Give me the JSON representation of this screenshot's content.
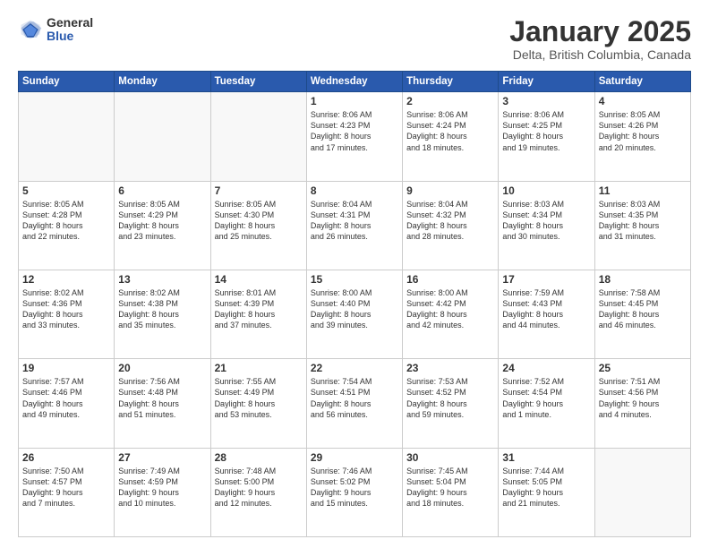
{
  "header": {
    "logo_general": "General",
    "logo_blue": "Blue",
    "title": "January 2025",
    "location": "Delta, British Columbia, Canada"
  },
  "weekdays": [
    "Sunday",
    "Monday",
    "Tuesday",
    "Wednesday",
    "Thursday",
    "Friday",
    "Saturday"
  ],
  "weeks": [
    [
      {
        "day": "",
        "text": "",
        "empty": true
      },
      {
        "day": "",
        "text": "",
        "empty": true
      },
      {
        "day": "",
        "text": "",
        "empty": true
      },
      {
        "day": "1",
        "text": "Sunrise: 8:06 AM\nSunset: 4:23 PM\nDaylight: 8 hours\nand 17 minutes.",
        "empty": false
      },
      {
        "day": "2",
        "text": "Sunrise: 8:06 AM\nSunset: 4:24 PM\nDaylight: 8 hours\nand 18 minutes.",
        "empty": false
      },
      {
        "day": "3",
        "text": "Sunrise: 8:06 AM\nSunset: 4:25 PM\nDaylight: 8 hours\nand 19 minutes.",
        "empty": false
      },
      {
        "day": "4",
        "text": "Sunrise: 8:05 AM\nSunset: 4:26 PM\nDaylight: 8 hours\nand 20 minutes.",
        "empty": false
      }
    ],
    [
      {
        "day": "5",
        "text": "Sunrise: 8:05 AM\nSunset: 4:28 PM\nDaylight: 8 hours\nand 22 minutes.",
        "empty": false
      },
      {
        "day": "6",
        "text": "Sunrise: 8:05 AM\nSunset: 4:29 PM\nDaylight: 8 hours\nand 23 minutes.",
        "empty": false
      },
      {
        "day": "7",
        "text": "Sunrise: 8:05 AM\nSunset: 4:30 PM\nDaylight: 8 hours\nand 25 minutes.",
        "empty": false
      },
      {
        "day": "8",
        "text": "Sunrise: 8:04 AM\nSunset: 4:31 PM\nDaylight: 8 hours\nand 26 minutes.",
        "empty": false
      },
      {
        "day": "9",
        "text": "Sunrise: 8:04 AM\nSunset: 4:32 PM\nDaylight: 8 hours\nand 28 minutes.",
        "empty": false
      },
      {
        "day": "10",
        "text": "Sunrise: 8:03 AM\nSunset: 4:34 PM\nDaylight: 8 hours\nand 30 minutes.",
        "empty": false
      },
      {
        "day": "11",
        "text": "Sunrise: 8:03 AM\nSunset: 4:35 PM\nDaylight: 8 hours\nand 31 minutes.",
        "empty": false
      }
    ],
    [
      {
        "day": "12",
        "text": "Sunrise: 8:02 AM\nSunset: 4:36 PM\nDaylight: 8 hours\nand 33 minutes.",
        "empty": false
      },
      {
        "day": "13",
        "text": "Sunrise: 8:02 AM\nSunset: 4:38 PM\nDaylight: 8 hours\nand 35 minutes.",
        "empty": false
      },
      {
        "day": "14",
        "text": "Sunrise: 8:01 AM\nSunset: 4:39 PM\nDaylight: 8 hours\nand 37 minutes.",
        "empty": false
      },
      {
        "day": "15",
        "text": "Sunrise: 8:00 AM\nSunset: 4:40 PM\nDaylight: 8 hours\nand 39 minutes.",
        "empty": false
      },
      {
        "day": "16",
        "text": "Sunrise: 8:00 AM\nSunset: 4:42 PM\nDaylight: 8 hours\nand 42 minutes.",
        "empty": false
      },
      {
        "day": "17",
        "text": "Sunrise: 7:59 AM\nSunset: 4:43 PM\nDaylight: 8 hours\nand 44 minutes.",
        "empty": false
      },
      {
        "day": "18",
        "text": "Sunrise: 7:58 AM\nSunset: 4:45 PM\nDaylight: 8 hours\nand 46 minutes.",
        "empty": false
      }
    ],
    [
      {
        "day": "19",
        "text": "Sunrise: 7:57 AM\nSunset: 4:46 PM\nDaylight: 8 hours\nand 49 minutes.",
        "empty": false
      },
      {
        "day": "20",
        "text": "Sunrise: 7:56 AM\nSunset: 4:48 PM\nDaylight: 8 hours\nand 51 minutes.",
        "empty": false
      },
      {
        "day": "21",
        "text": "Sunrise: 7:55 AM\nSunset: 4:49 PM\nDaylight: 8 hours\nand 53 minutes.",
        "empty": false
      },
      {
        "day": "22",
        "text": "Sunrise: 7:54 AM\nSunset: 4:51 PM\nDaylight: 8 hours\nand 56 minutes.",
        "empty": false
      },
      {
        "day": "23",
        "text": "Sunrise: 7:53 AM\nSunset: 4:52 PM\nDaylight: 8 hours\nand 59 minutes.",
        "empty": false
      },
      {
        "day": "24",
        "text": "Sunrise: 7:52 AM\nSunset: 4:54 PM\nDaylight: 9 hours\nand 1 minute.",
        "empty": false
      },
      {
        "day": "25",
        "text": "Sunrise: 7:51 AM\nSunset: 4:56 PM\nDaylight: 9 hours\nand 4 minutes.",
        "empty": false
      }
    ],
    [
      {
        "day": "26",
        "text": "Sunrise: 7:50 AM\nSunset: 4:57 PM\nDaylight: 9 hours\nand 7 minutes.",
        "empty": false
      },
      {
        "day": "27",
        "text": "Sunrise: 7:49 AM\nSunset: 4:59 PM\nDaylight: 9 hours\nand 10 minutes.",
        "empty": false
      },
      {
        "day": "28",
        "text": "Sunrise: 7:48 AM\nSunset: 5:00 PM\nDaylight: 9 hours\nand 12 minutes.",
        "empty": false
      },
      {
        "day": "29",
        "text": "Sunrise: 7:46 AM\nSunset: 5:02 PM\nDaylight: 9 hours\nand 15 minutes.",
        "empty": false
      },
      {
        "day": "30",
        "text": "Sunrise: 7:45 AM\nSunset: 5:04 PM\nDaylight: 9 hours\nand 18 minutes.",
        "empty": false
      },
      {
        "day": "31",
        "text": "Sunrise: 7:44 AM\nSunset: 5:05 PM\nDaylight: 9 hours\nand 21 minutes.",
        "empty": false
      },
      {
        "day": "",
        "text": "",
        "empty": true
      }
    ]
  ]
}
